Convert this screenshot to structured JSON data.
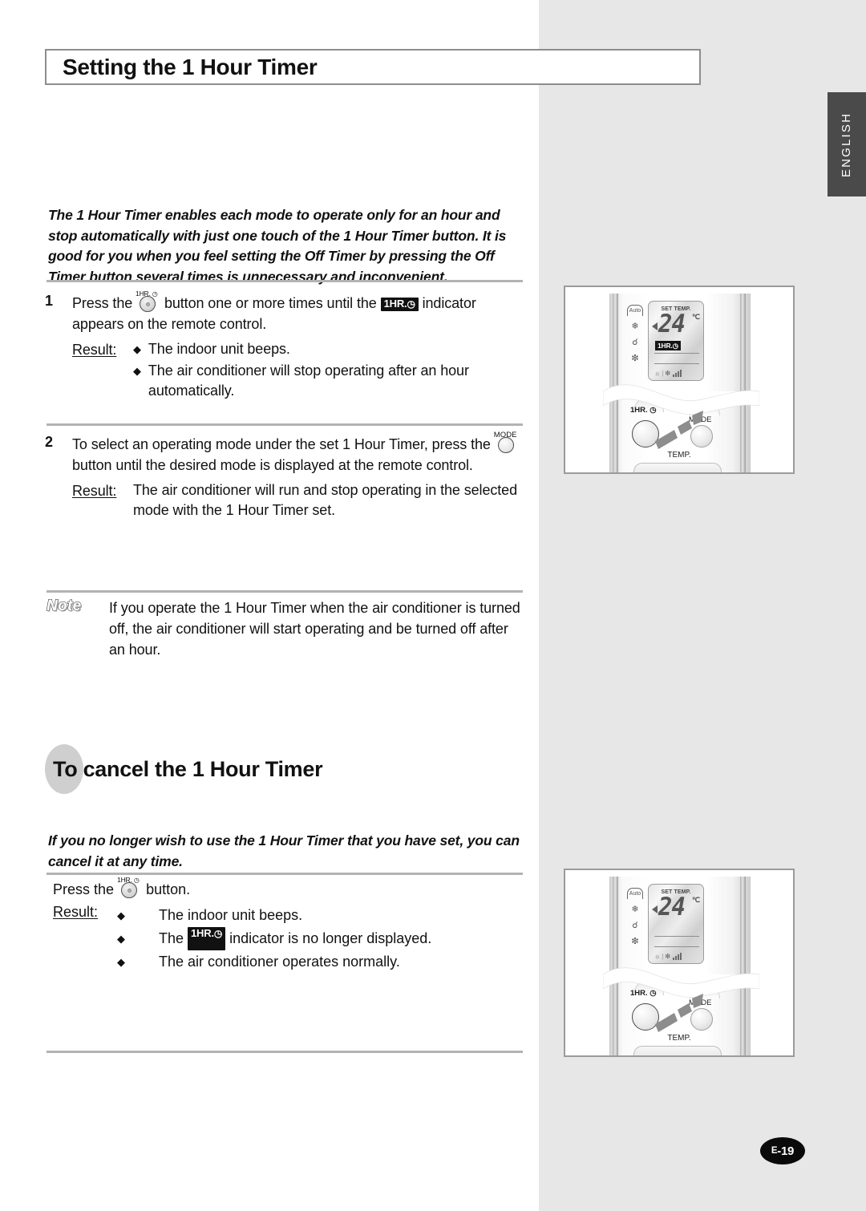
{
  "page": {
    "language_tab": "ENGLISH",
    "page_number_prefix": "E",
    "page_number": "-19",
    "page_number_full": "E-19"
  },
  "section1": {
    "title": "Setting the 1 Hour Timer",
    "intro": "The 1 Hour Timer enables each mode to operate only for an hour and stop automatically with just one touch of the 1 Hour Timer button. It is good for you when you feel setting the Off Timer by pressing the Off Timer button several times is unnecessary and inconvenient.",
    "steps": [
      {
        "number": "1",
        "text_before_button": "Press the",
        "button_caption": "1HR.",
        "button_icon": "clock-icon",
        "text_after_button": "button one or more times until the",
        "indicator_label": "1HR.",
        "text_after_indicator": "indicator appears on the remote control.",
        "result_label": "Result:",
        "results": [
          "The indoor unit beeps.",
          "The air conditioner will stop operating after an hour automatically."
        ]
      },
      {
        "number": "2",
        "text_before_button": "To select an operating mode under the set 1 Hour Timer, press the",
        "button_caption": "MODE",
        "text_after_button": "button until the desired mode is displayed at the remote control.",
        "result_label": "Result:",
        "results": [
          "The air conditioner will run and stop operating in the selected mode with the 1 Hour Timer set."
        ]
      }
    ],
    "note": {
      "label": "Note",
      "text": "If you operate the 1 Hour Timer when the air conditioner is turned off, the air conditioner will start operating and be turned off after an hour."
    }
  },
  "section2": {
    "title_highlight": "To",
    "title_rest": "cancel the 1 Hour Timer",
    "title_full": "To cancel the 1 Hour Timer",
    "intro": "If you no longer wish to use the 1 Hour Timer that you have set, you can cancel it at any time.",
    "press_before": "Press the",
    "press_button_caption": "1HR.",
    "press_after": "button.",
    "result_label": "Result:",
    "results": [
      {
        "before": "The indoor unit beeps.",
        "badge": "",
        "after": ""
      },
      {
        "before": "The",
        "badge": "1HR.",
        "after": "indicator is no longer displayed."
      },
      {
        "before": "The air conditioner operates normally.",
        "badge": "",
        "after": ""
      }
    ]
  },
  "illustration": {
    "lcd": {
      "set_temp_label": "SET TEMP.",
      "temperature": "24",
      "unit": "℃",
      "timer_badge": "1HR.",
      "timer_badge_visible_top": true,
      "timer_badge_visible_bottom": false
    },
    "mode_icons": [
      "auto-mode-icon",
      "cool-snowflake-icon",
      "dry-droplet-icon",
      "fan-icon"
    ],
    "mode_icon_auto_label": "Auto",
    "buttons": {
      "timer_label": "1HR.",
      "mode_label": "MODE",
      "temp_label": "TEMP."
    }
  },
  "colors": {
    "panel_gray": "#e7e7e7",
    "tab_dark": "#4a4a4a",
    "rule_gray": "#b3b3b3",
    "badge_black": "#111111",
    "ellipse_gray": "#cfcfcf"
  }
}
